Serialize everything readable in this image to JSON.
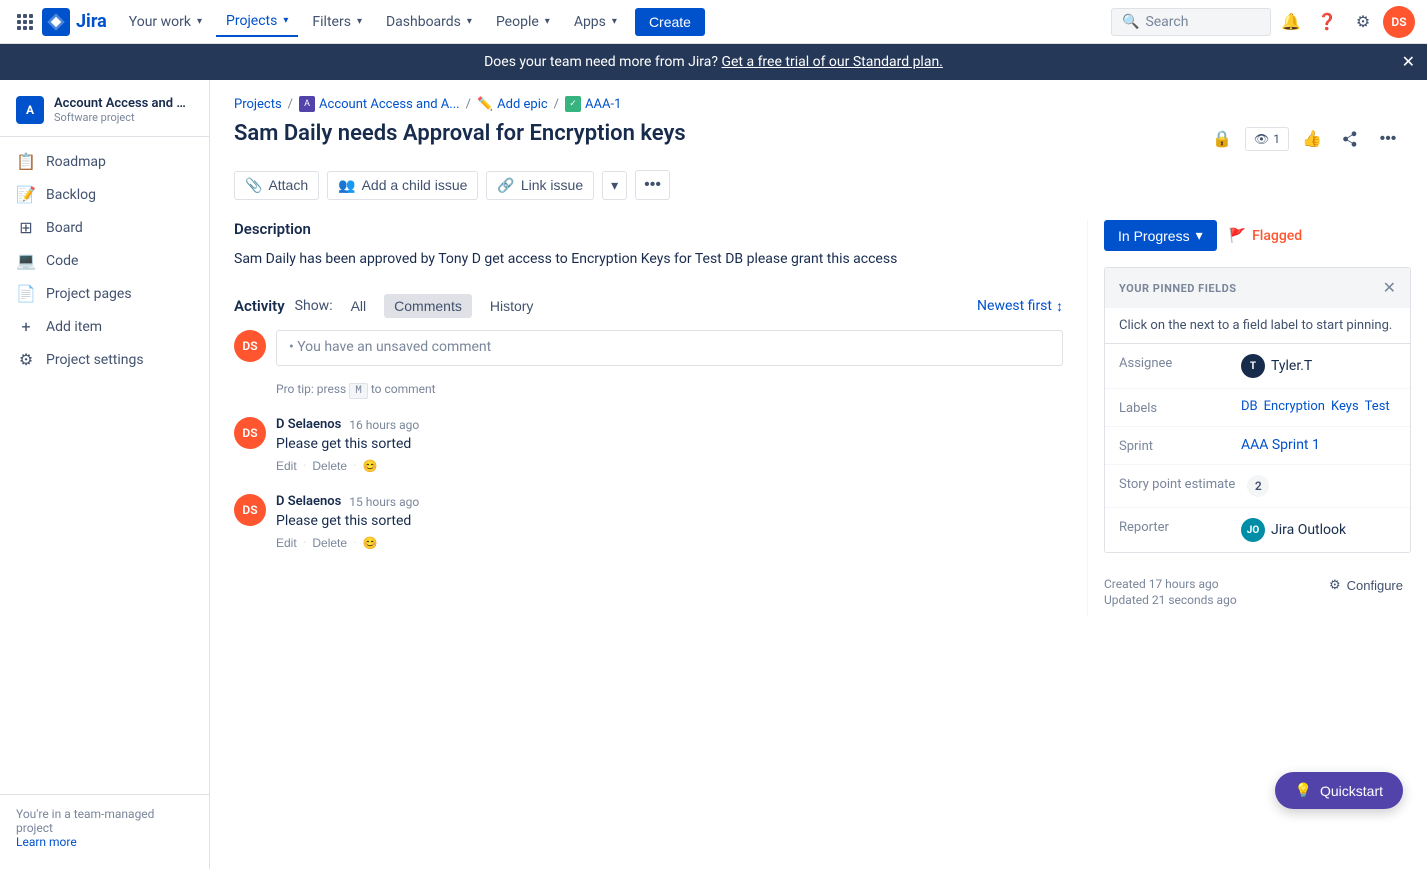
{
  "topnav": {
    "logo_text": "Jira",
    "your_work": "Your work",
    "projects": "Projects",
    "filters": "Filters",
    "dashboards": "Dashboards",
    "people": "People",
    "apps": "Apps",
    "create": "Create",
    "search_placeholder": "Search",
    "avatar_initials": "DS"
  },
  "banner": {
    "text": "Does your team need more from Jira?",
    "link_text": "Get a free trial of our Standard plan."
  },
  "sidebar": {
    "project_name": "Account Access and Ap...",
    "project_type": "Software project",
    "project_icon": "A",
    "items": [
      {
        "id": "roadmap",
        "label": "Roadmap",
        "icon": "📋"
      },
      {
        "id": "backlog",
        "label": "Backlog",
        "icon": "📝"
      },
      {
        "id": "board",
        "label": "Board",
        "icon": "⊞"
      },
      {
        "id": "code",
        "label": "Code",
        "icon": "💻"
      },
      {
        "id": "project-pages",
        "label": "Project pages",
        "icon": "📄"
      },
      {
        "id": "add-item",
        "label": "Add item",
        "icon": "+"
      },
      {
        "id": "project-settings",
        "label": "Project settings",
        "icon": "⚙"
      }
    ],
    "footer_text": "You're in a team-managed project",
    "footer_link": "Learn more"
  },
  "breadcrumb": {
    "projects": "Projects",
    "project": "Account Access and A...",
    "epic": "Add epic",
    "issue": "AAA-1"
  },
  "issue": {
    "title": "Sam Daily needs Approval for Encryption keys",
    "description_heading": "Description",
    "description": "Sam Daily has been approved by Tony D  get access to Encryption Keys for Test DB please grant this access",
    "toolbar": {
      "attach": "Attach",
      "add_child": "Add a child issue",
      "link_issue": "Link issue"
    }
  },
  "activity": {
    "heading": "Activity",
    "show_label": "Show:",
    "tabs": [
      "All",
      "Comments",
      "History"
    ],
    "active_tab": "Comments",
    "sort_label": "Newest first",
    "comment_placeholder": "• You have an unsaved comment",
    "pro_tip": "Pro tip: press",
    "key_hint": "M",
    "key_suffix": "to comment",
    "comments": [
      {
        "author": "D Selaenos",
        "time": "16 hours ago",
        "text": "Please get this sorted",
        "avatar_color": "#FF5630",
        "avatar_initials": "DS",
        "actions": [
          "Edit",
          "Delete"
        ]
      },
      {
        "author": "D Selaenos",
        "time": "15 hours ago",
        "text": "Please get this sorted",
        "avatar_color": "#FF5630",
        "avatar_initials": "DS",
        "actions": [
          "Edit",
          "Delete"
        ]
      }
    ]
  },
  "right_panel": {
    "status": "In Progress",
    "flagged": "Flagged",
    "pinned_fields_title": "YOUR PINNED FIELDS",
    "pinned_hint": "Click on the  next to a field label to start pinning.",
    "fields": {
      "assignee_label": "Assignee",
      "assignee_name": "Tyler.T",
      "assignee_avatar_color": "#172B4D",
      "assignee_avatar_initials": "T",
      "labels_label": "Labels",
      "labels": [
        "DB",
        "Encryption",
        "Keys",
        "Test"
      ],
      "sprint_label": "Sprint",
      "sprint_value": "AAA Sprint 1",
      "story_points_label": "Story point estimate",
      "story_points": "2",
      "reporter_label": "Reporter",
      "reporter_name": "Jira Outlook",
      "reporter_avatar_color": "#008DA6",
      "reporter_avatar_initials": "JO"
    },
    "created": "Created 17 hours ago",
    "updated": "Updated 21 seconds ago",
    "configure": "Configure"
  },
  "quickstart": {
    "label": "Quickstart"
  }
}
